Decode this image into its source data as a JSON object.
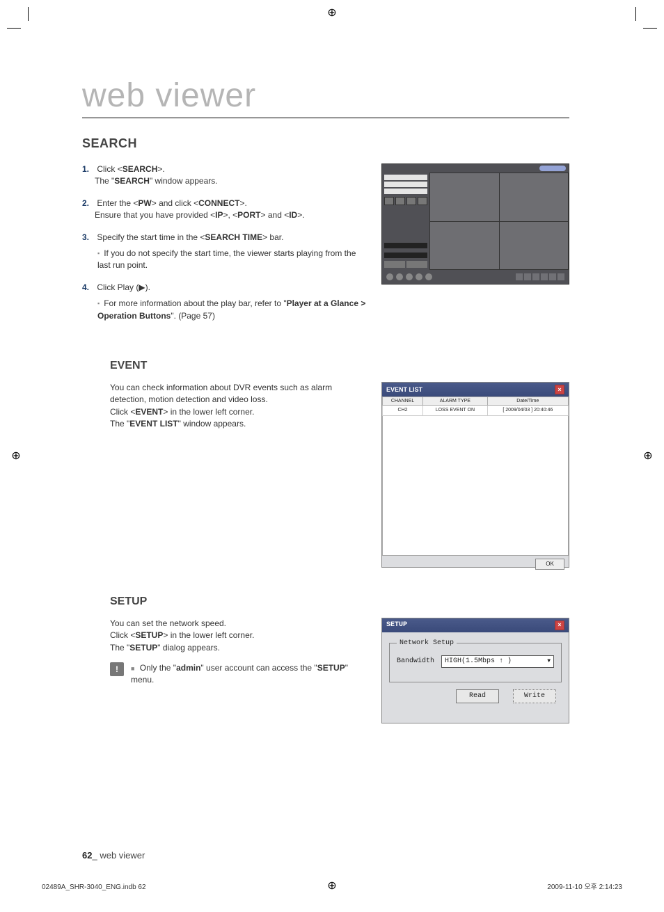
{
  "chapter_title": "web viewer",
  "search": {
    "heading": "SEARCH",
    "step1_a": "Click <",
    "step1_b": "SEARCH",
    "step1_c": ">.",
    "step1_sub_a": "The \"",
    "step1_sub_b": "SEARCH",
    "step1_sub_c": "\" window appears.",
    "step2_a": "Enter the <",
    "step2_b": "PW",
    "step2_c": "> and click <",
    "step2_d": "CONNECT",
    "step2_e": ">.",
    "step2_sub_a": "Ensure that you have provided <",
    "step2_sub_b": "IP",
    "step2_sub_c": ">, <",
    "step2_sub_d": "PORT",
    "step2_sub_e": "> and <",
    "step2_sub_f": "ID",
    "step2_sub_g": ">.",
    "step3_a": "Specify the start time in the <",
    "step3_b": "SEARCH TIME",
    "step3_c": "> bar.",
    "step3_bullet": "If you do not specify the start time, the viewer starts playing from the last run point.",
    "step4_a": "Click Play (▶).",
    "step4_bullet_a": "For more information about the play bar, refer to \"",
    "step4_bullet_b": "Player at a Glance > Operation Buttons",
    "step4_bullet_c": "\". (Page 57)"
  },
  "event": {
    "heading": "EVENT",
    "p1": "You can check information about DVR events such as alarm detection, motion detection and video loss.",
    "p2_a": "Click <",
    "p2_b": "EVENT",
    "p2_c": "> in the lower left corner.",
    "p3_a": "The \"",
    "p3_b": "EVENT LIST",
    "p3_c": "\" window appears.",
    "dialog": {
      "title": "EVENT LIST",
      "col1": "CHANNEL",
      "col2": "ALARM TYPE",
      "col3": "Date/Time",
      "row_ch": "CH2",
      "row_type": "LOSS EVENT ON",
      "row_dt": "[ 2009/04/03 ] 20:40:46",
      "ok": "OK"
    }
  },
  "setup": {
    "heading": "SETUP",
    "p1": "You can set the network speed.",
    "p2_a": "Click <",
    "p2_b": "SETUP",
    "p2_c": "> in the lower left corner.",
    "p3_a": "The \"",
    "p3_b": "SETUP",
    "p3_c": "\" dialog appears.",
    "note_a": "Only the \"",
    "note_b": "admin",
    "note_c": "\" user account can access the \"",
    "note_d": "SETUP",
    "note_e": "\" menu.",
    "dialog": {
      "title": "SETUP",
      "legend": "Network Setup",
      "label": "Bandwidth",
      "value": "HIGH(1.5Mbps ↑ )",
      "read": "Read",
      "write": "Write"
    }
  },
  "footer": {
    "page": "62",
    "sep": "_",
    "label": "web viewer"
  },
  "slug_left": "02489A_SHR-3040_ENG.indb   62",
  "slug_right": "2009-11-10   오후 2:14:23",
  "numbers": {
    "n1": "1.",
    "n2": "2.",
    "n3": "3.",
    "n4": "4."
  }
}
